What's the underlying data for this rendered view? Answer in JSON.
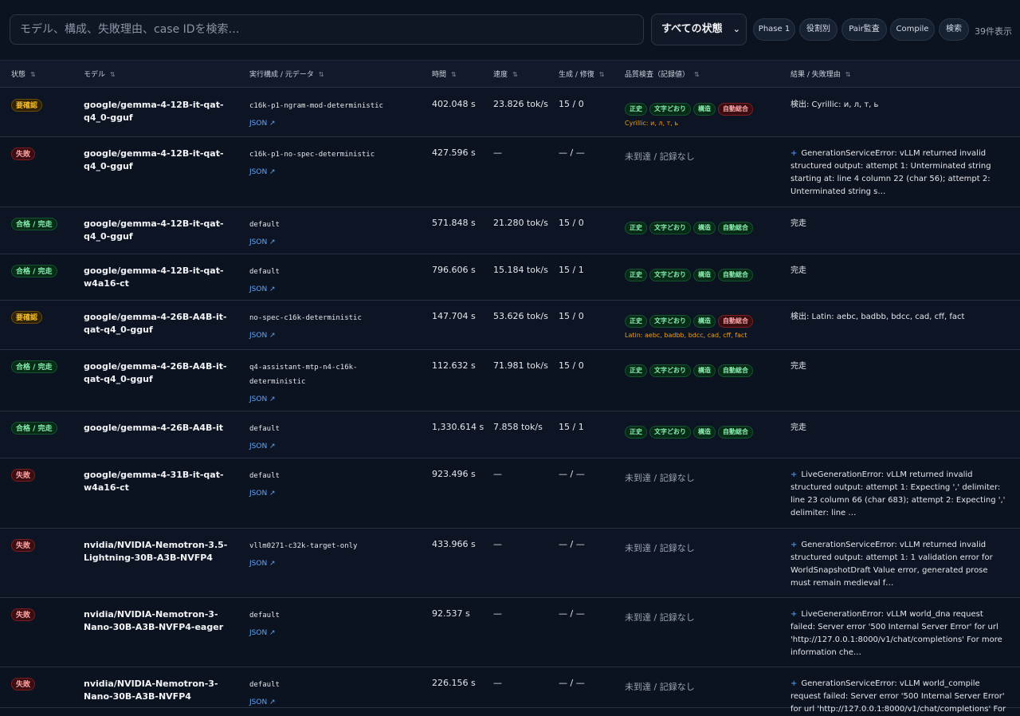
{
  "toolbar": {
    "search_placeholder": "モデル、構成、失敗理由、case IDを検索…",
    "status_filter": "すべての状態",
    "buttons": [
      "Phase 1",
      "役割別",
      "Pair監査",
      "Compile",
      "検索"
    ],
    "shown_count": "39件表示"
  },
  "table": {
    "headers": [
      "状態",
      "モデル",
      "実行構成 / 元データ",
      "時間",
      "速度",
      "生成 / 修復",
      "品質検査（記録値）",
      "結果 / 失敗理由"
    ],
    "rows": [
      {
        "status": "要確認",
        "status_type": "warn",
        "model": "google/gemma-4-12B-it-qat-q4_0-gguf",
        "config": "c16k-p1-ngram-mod-deterministic",
        "json_label": "JSON ↗",
        "time": "402.048 s",
        "speed": "23.826 tok/s",
        "gen_repair": "15 / 0",
        "qc_badges": [
          "正史",
          "文字どおり",
          "構造",
          "自動総合"
        ],
        "qc_badge_types": [
          "green",
          "green",
          "green",
          "red"
        ],
        "qc_note": "Cyrillic: и, л, т, ь",
        "qc_empty": "",
        "result_plus": "",
        "result": "検出: Cyrillic: и, л, т, ь"
      },
      {
        "status": "失敗",
        "status_type": "fail",
        "model": "google/gemma-4-12B-it-qat-q4_0-gguf",
        "config": "c16k-p1-no-spec-deterministic",
        "json_label": "JSON ↗",
        "time": "427.596 s",
        "speed": "—",
        "gen_repair": "— / —",
        "qc_badges": [],
        "qc_badge_types": [],
        "qc_note": "",
        "qc_empty": "未到達 / 記録なし",
        "result_plus": "+",
        "result": "GenerationServiceError: vLLM returned invalid structured output: attempt 1: Unterminated string starting at: line 4 column 22 (char 56); attempt 2: Unterminated string s…"
      },
      {
        "status": "合格 / 完走",
        "status_type": "pass",
        "model": "google/gemma-4-12B-it-qat-q4_0-gguf",
        "config": "default",
        "json_label": "JSON ↗",
        "time": "571.848 s",
        "speed": "21.280 tok/s",
        "gen_repair": "15 / 0",
        "qc_badges": [
          "正史",
          "文字どおり",
          "構造",
          "自動総合"
        ],
        "qc_badge_types": [
          "green",
          "green",
          "green",
          "green"
        ],
        "qc_note": "",
        "qc_empty": "",
        "result_plus": "",
        "result": "完走"
      },
      {
        "status": "合格 / 完走",
        "status_type": "pass",
        "model": "google/gemma-4-12B-it-qat-w4a16-ct",
        "config": "default",
        "json_label": "JSON ↗",
        "time": "796.606 s",
        "speed": "15.184 tok/s",
        "gen_repair": "15 / 1",
        "qc_badges": [
          "正史",
          "文字どおり",
          "構造",
          "自動総合"
        ],
        "qc_badge_types": [
          "green",
          "green",
          "green",
          "green"
        ],
        "qc_note": "",
        "qc_empty": "",
        "result_plus": "",
        "result": "完走"
      },
      {
        "status": "要確認",
        "status_type": "warn",
        "model": "google/gemma-4-26B-A4B-it-qat-q4_0-gguf",
        "config": "no-spec-c16k-deterministic",
        "json_label": "JSON ↗",
        "time": "147.704 s",
        "speed": "53.626 tok/s",
        "gen_repair": "15 / 0",
        "qc_badges": [
          "正史",
          "文字どおり",
          "構造",
          "自動総合"
        ],
        "qc_badge_types": [
          "green",
          "green",
          "green",
          "red"
        ],
        "qc_note": "Latin: aebc, badbb, bdcc, cad, cff, fact",
        "qc_empty": "",
        "result_plus": "",
        "result": "検出: Latin: aebc, badbb, bdcc, cad, cff, fact"
      },
      {
        "status": "合格 / 完走",
        "status_type": "pass",
        "model": "google/gemma-4-26B-A4B-it-qat-q4_0-gguf",
        "config": "q4-assistant-mtp-n4-c16k-deterministic",
        "json_label": "JSON ↗",
        "time": "112.632 s",
        "speed": "71.981 tok/s",
        "gen_repair": "15 / 0",
        "qc_badges": [
          "正史",
          "文字どおり",
          "構造",
          "自動総合"
        ],
        "qc_badge_types": [
          "green",
          "green",
          "green",
          "green"
        ],
        "qc_note": "",
        "qc_empty": "",
        "result_plus": "",
        "result": "完走"
      },
      {
        "status": "合格 / 完走",
        "status_type": "pass",
        "model": "google/gemma-4-26B-A4B-it",
        "config": "default",
        "json_label": "JSON ↗",
        "time": "1,330.614 s",
        "speed": "7.858 tok/s",
        "gen_repair": "15 / 1",
        "qc_badges": [
          "正史",
          "文字どおり",
          "構造",
          "自動総合"
        ],
        "qc_badge_types": [
          "green",
          "green",
          "green",
          "green"
        ],
        "qc_note": "",
        "qc_empty": "",
        "result_plus": "",
        "result": "完走"
      },
      {
        "status": "失敗",
        "status_type": "fail",
        "model": "google/gemma-4-31B-it-qat-w4a16-ct",
        "config": "default",
        "json_label": "JSON ↗",
        "time": "923.496 s",
        "speed": "—",
        "gen_repair": "— / —",
        "qc_badges": [],
        "qc_badge_types": [],
        "qc_note": "",
        "qc_empty": "未到達 / 記録なし",
        "result_plus": "+",
        "result": "LiveGenerationError: vLLM returned invalid structured output: attempt 1: Expecting ',' delimiter: line 23 column 66 (char 683); attempt 2: Expecting ',' delimiter: line …"
      },
      {
        "status": "失敗",
        "status_type": "fail",
        "model": "nvidia/NVIDIA-Nemotron-3.5-Lightning-30B-A3B-NVFP4",
        "config": "vllm0271-c32k-target-only",
        "json_label": "JSON ↗",
        "time": "433.966 s",
        "speed": "—",
        "gen_repair": "— / —",
        "qc_badges": [],
        "qc_badge_types": [],
        "qc_note": "",
        "qc_empty": "未到達 / 記録なし",
        "result_plus": "+",
        "result": "GenerationServiceError: vLLM returned invalid structured output: attempt 1: 1 validation error for WorldSnapshotDraft Value error, generated prose must remain medieval f…"
      },
      {
        "status": "失敗",
        "status_type": "fail",
        "model": "nvidia/NVIDIA-Nemotron-3-Nano-30B-A3B-NVFP4-eager",
        "config": "default",
        "json_label": "JSON ↗",
        "time": "92.537 s",
        "speed": "—",
        "gen_repair": "— / —",
        "qc_badges": [],
        "qc_badge_types": [],
        "qc_note": "",
        "qc_empty": "未到達 / 記録なし",
        "result_plus": "+",
        "result": "LiveGenerationError: vLLM world_dna request failed: Server error '500 Internal Server Error' for url 'http://127.0.0.1:8000/v1/chat/completions' For more information che…"
      },
      {
        "status": "失敗",
        "status_type": "fail",
        "model": "nvidia/NVIDIA-Nemotron-3-Nano-30B-A3B-NVFP4",
        "config": "default",
        "json_label": "JSON ↗",
        "time": "226.156 s",
        "speed": "—",
        "gen_repair": "— / —",
        "qc_badges": [],
        "qc_badge_types": [],
        "qc_note": "",
        "qc_empty": "未到達 / 記録なし",
        "result_plus": "+",
        "result": "GenerationServiceError: vLLM world_compile request failed: Server error '500 Internal Server Error' for url 'http://127.0.0.1:8000/v1/chat/completions' For"
      }
    ]
  }
}
